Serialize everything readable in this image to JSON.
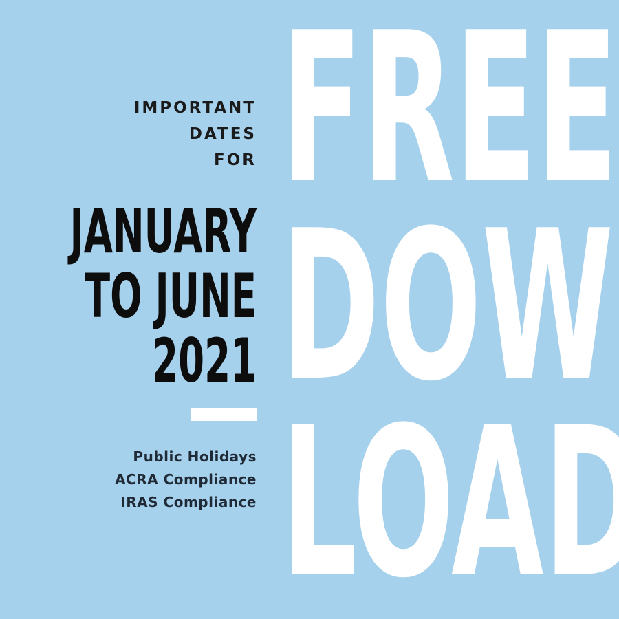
{
  "intro": {
    "line1": "IMPORTANT",
    "line2": "DATES",
    "line3": "FOR"
  },
  "date_range": {
    "line1": "JANUARY",
    "line2": "TO JUNE",
    "line3": "2021"
  },
  "topics": [
    "Public Holidays",
    "ACRA Compliance",
    "IRAS Compliance"
  ],
  "headline": {
    "line1": "FREE",
    "line2": "DOWN",
    "line3": "LOAD"
  },
  "colors": {
    "background": "#a6d1ec",
    "headline": "#ffffff",
    "text": "#0d0d0d"
  }
}
